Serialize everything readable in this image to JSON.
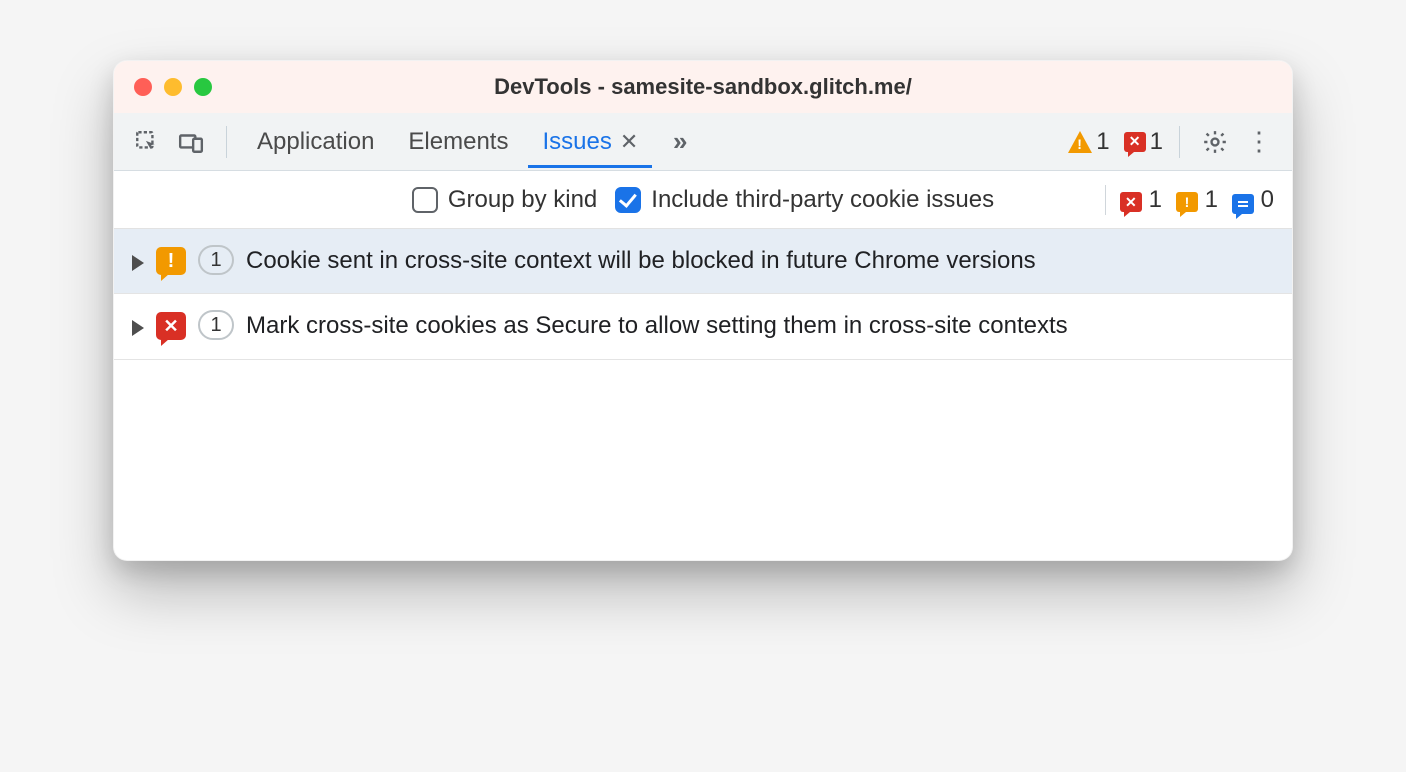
{
  "window": {
    "title": "DevTools - samesite-sandbox.glitch.me/"
  },
  "tabs": {
    "application": "Application",
    "elements": "Elements",
    "issues": "Issues"
  },
  "header_counts": {
    "warning": "1",
    "error": "1"
  },
  "subbar": {
    "group_by_kind_label": "Group by kind",
    "include_tp_label": "Include third-party cookie issues",
    "group_by_kind_checked": false,
    "include_tp_checked": true,
    "counts": {
      "error": "1",
      "warning": "1",
      "info": "0"
    }
  },
  "issues": [
    {
      "severity": "warning",
      "count": "1",
      "text": "Cookie sent in cross-site context will be blocked in future Chrome versions",
      "selected": true
    },
    {
      "severity": "error",
      "count": "1",
      "text": "Mark cross-site cookies as Secure to allow setting them in cross-site contexts",
      "selected": false
    }
  ]
}
